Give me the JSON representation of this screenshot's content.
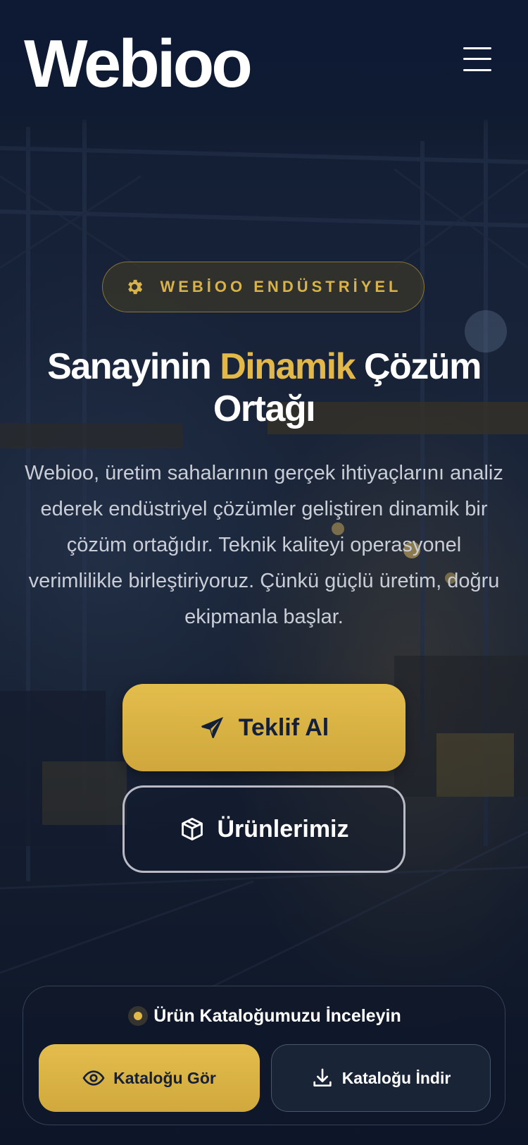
{
  "header": {
    "logo_text": "Webioo",
    "menu_icon": "hamburger-menu-icon"
  },
  "hero": {
    "badge": {
      "icon": "gear-icon",
      "label": "WEBİOO ENDÜSTRİYEL"
    },
    "headline": {
      "part1": "Sanayinin ",
      "accent": "Dinamik",
      "part2": " Çözüm Ortağı"
    },
    "lead": "Webioo, üretim sahalarının gerçek ihtiyaçlarını analiz ederek endüstriyel çözümler geliştiren dinamik bir çözüm ortağıdır. Teknik kaliteyi operasyonel verimlilikle birleştiriyoruz. Çünkü güçlü üretim, doğru ekipmanla başlar.",
    "primary_button": {
      "icon": "paper-plane-icon",
      "label": "Teklif Al"
    },
    "secondary_button": {
      "icon": "box-icon",
      "label": "Ürünlerimiz"
    }
  },
  "catalog": {
    "title": "Ürün Kataloğumuzu İnceleyin",
    "view_button": {
      "icon": "eye-icon",
      "label": "Kataloğu Gör"
    },
    "download_button": {
      "icon": "download-icon",
      "label": "Kataloğu İndir"
    }
  },
  "colors": {
    "background": "#0c1527",
    "accent": "#e2b84b",
    "text": "#ffffff",
    "muted_text": "#c9cdd6"
  }
}
